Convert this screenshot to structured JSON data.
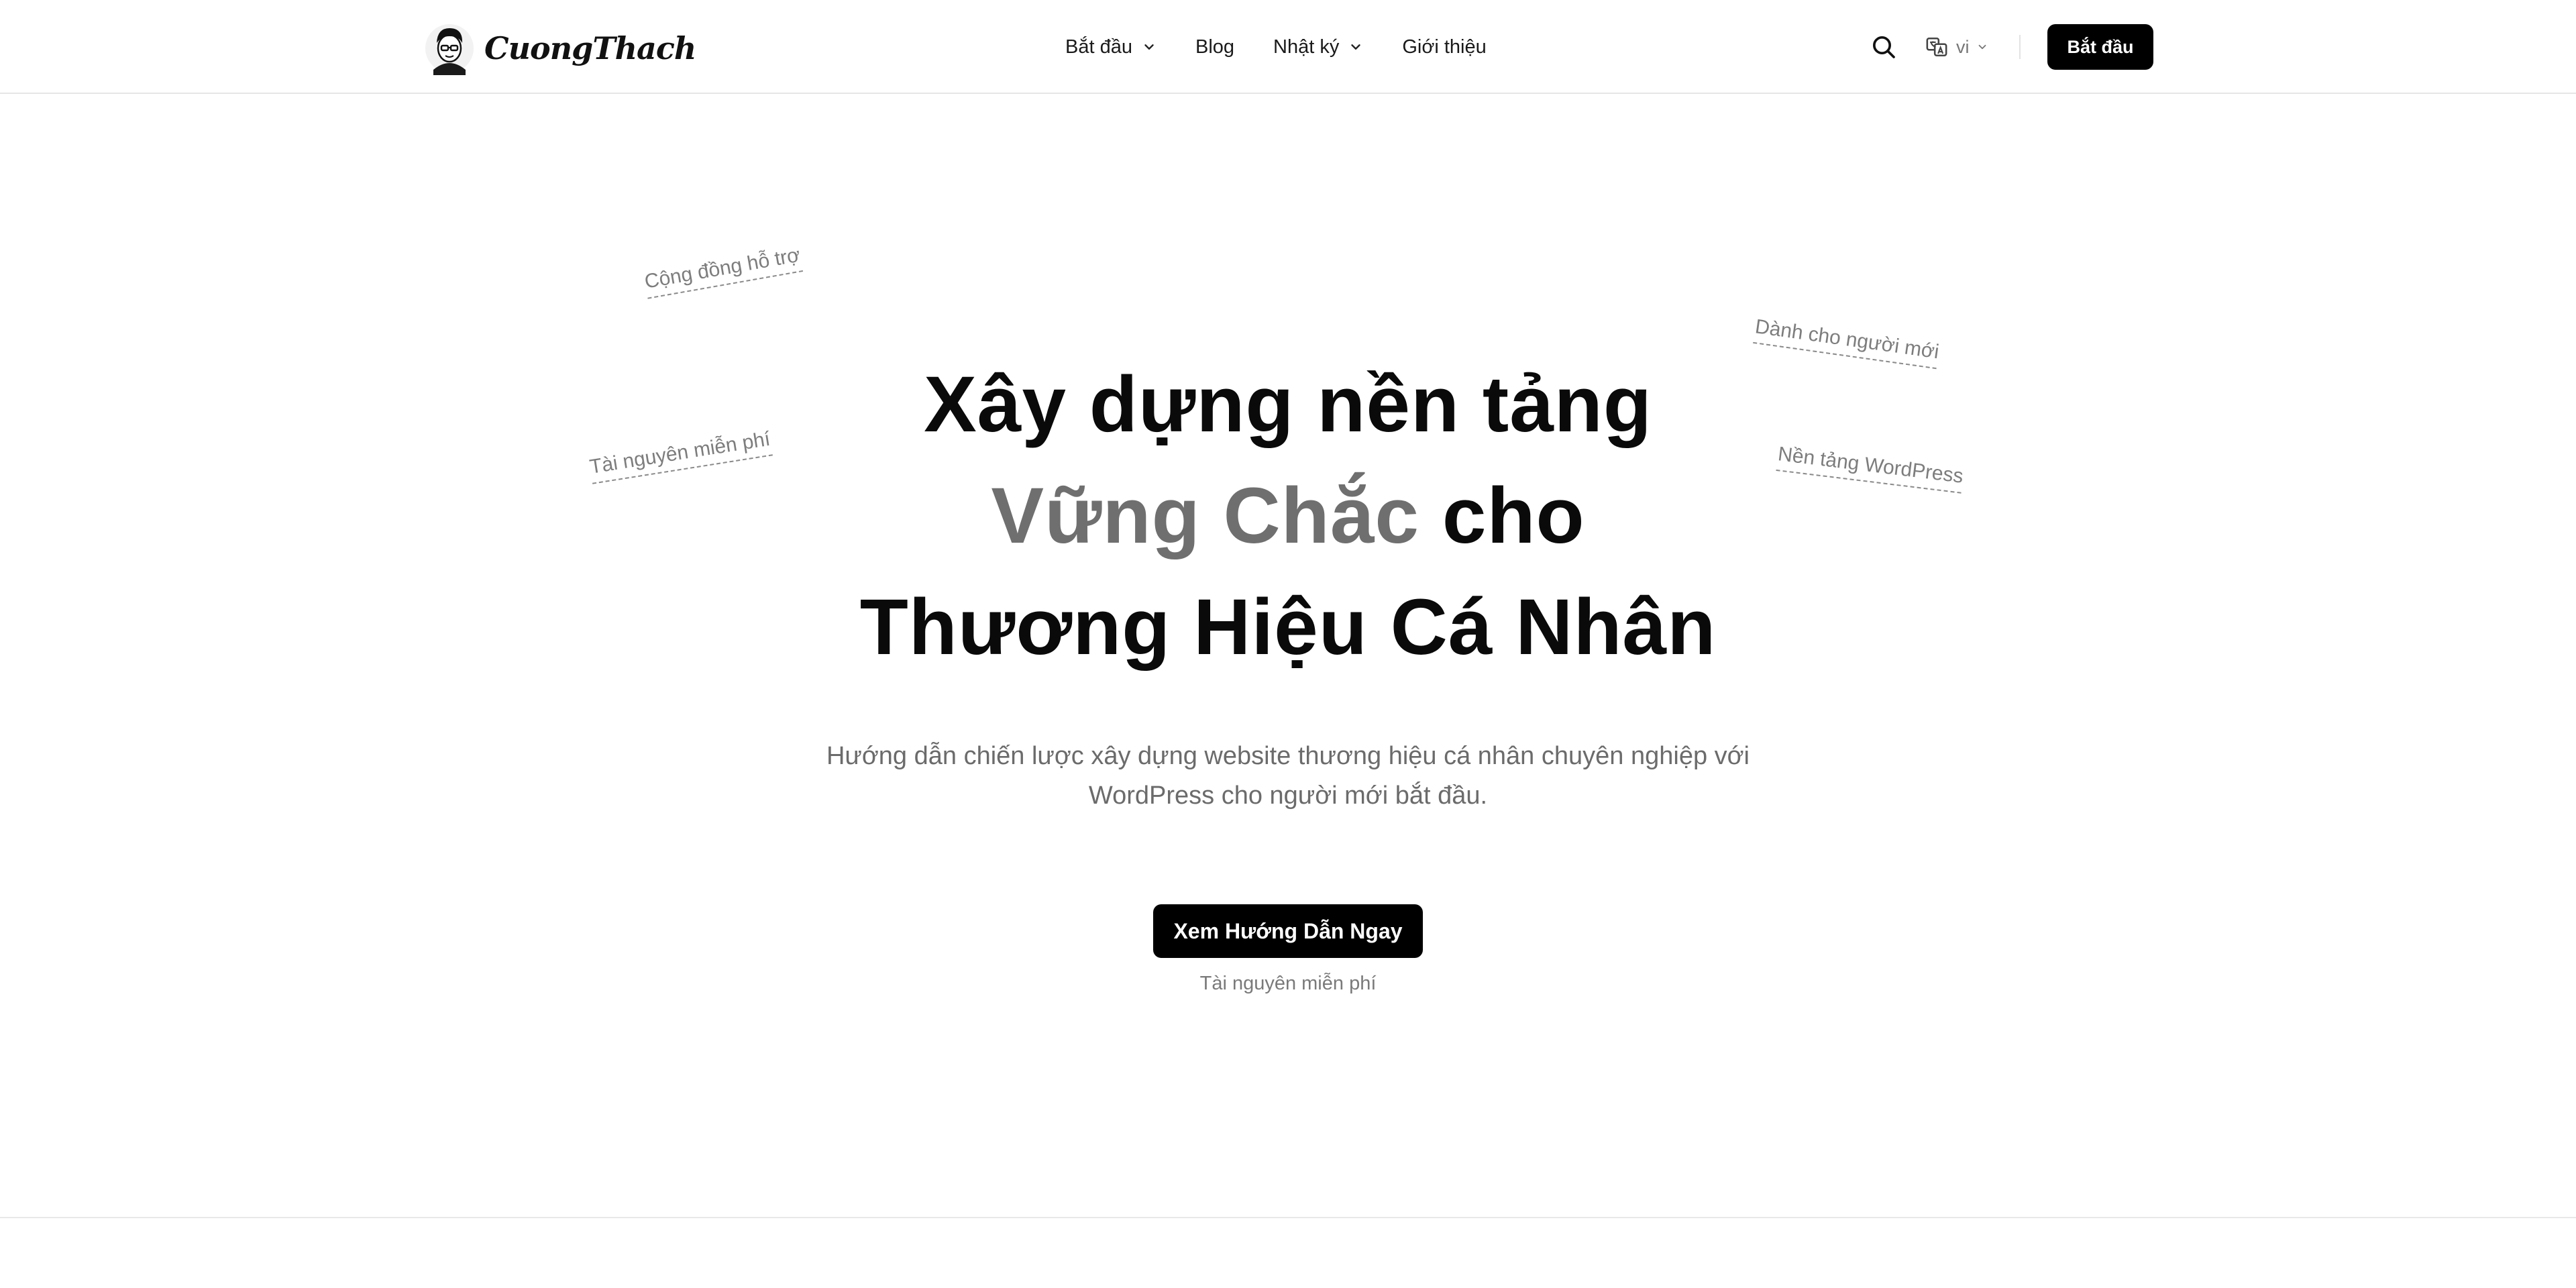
{
  "header": {
    "logo_text": "CuongThach",
    "nav": [
      {
        "label": "Bắt đầu",
        "has_dropdown": true
      },
      {
        "label": "Blog",
        "has_dropdown": false
      },
      {
        "label": "Nhật ký",
        "has_dropdown": true
      },
      {
        "label": "Giới thiệu",
        "has_dropdown": false
      }
    ],
    "search_icon": "search-icon",
    "language": {
      "icon": "translate-icon",
      "value": "vi"
    },
    "cta_label": "Bắt đầu"
  },
  "hero": {
    "title_line1": "Xây dựng nền tảng",
    "title_line2_highlight": "Vững Chắc",
    "title_line2_rest": "cho",
    "title_line3": "Thương Hiệu Cá Nhân",
    "subtitle": "Hướng dẫn chiến lược xây dựng website thương hiệu cá nhân chuyên nghiệp với WordPress cho người mới bắt đầu.",
    "cta_label": "Xem Hướng Dẫn Ngay",
    "note": "Tài nguyên miễn phí"
  },
  "floating_tags": [
    "Cộng đồng hỗ trợ",
    "Tài nguyên miễn phí",
    "Dành cho người mới",
    "Nền tảng WordPress"
  ],
  "colors": {
    "primary": "#000000",
    "muted_text": "#6f6f6f",
    "background": "#ffffff"
  }
}
